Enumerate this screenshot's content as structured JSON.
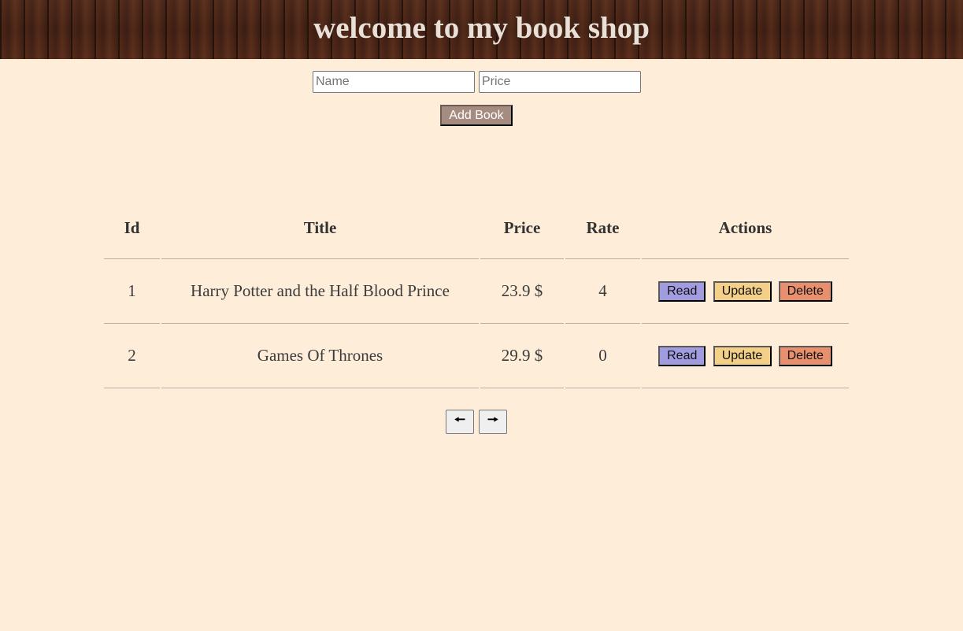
{
  "header": {
    "title": "welcome to my book shop"
  },
  "form": {
    "name_placeholder": "Name",
    "price_placeholder": "Price",
    "add_label": "Add Book"
  },
  "table": {
    "columns": [
      "Id",
      "Title",
      "Price",
      "Rate",
      "Actions"
    ],
    "rows": [
      {
        "id": "1",
        "title": "Harry Potter and the Half Blood Prince",
        "price": "23.9 $",
        "rate": "4",
        "actions": {
          "read": "Read",
          "update": "Update",
          "delete": "Delete"
        }
      },
      {
        "id": "2",
        "title": "Games Of Thrones",
        "price": "29.9 $",
        "rate": "0",
        "actions": {
          "read": "Read",
          "update": "Update",
          "delete": "Delete"
        }
      }
    ]
  },
  "pager": {
    "prev_icon": "arrow-left-icon",
    "prev_glyph": "🠔",
    "next_icon": "arrow-right-icon",
    "next_glyph": "🠖"
  },
  "colors": {
    "page_background": "#feedd8",
    "read_button": "#a19ce0",
    "update_button": "#f3cf88",
    "delete_button": "#e8906d",
    "add_button": "#a58b80"
  }
}
